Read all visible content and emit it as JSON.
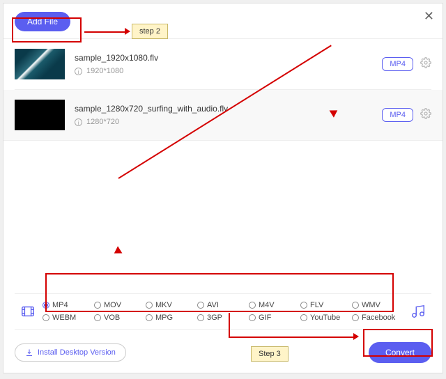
{
  "header": {
    "add_file_label": "Add File"
  },
  "files": [
    {
      "name": "sample_1920x1080.flv",
      "resolution": "1920*1080",
      "target_format": "MP4"
    },
    {
      "name": "sample_1280x720_surfing_with_audio.flv",
      "resolution": "1280*720",
      "target_format": "MP4"
    }
  ],
  "formats": {
    "row1": [
      "MP4",
      "MOV",
      "MKV",
      "AVI",
      "M4V",
      "FLV",
      "WMV"
    ],
    "row2": [
      "WEBM",
      "VOB",
      "MPG",
      "3GP",
      "GIF",
      "YouTube",
      "Facebook"
    ],
    "selected": "MP4"
  },
  "footer": {
    "install_label": "Install Desktop Version",
    "convert_label": "Convert"
  },
  "annotations": {
    "step2": "step 2",
    "step3": "Step 3"
  }
}
